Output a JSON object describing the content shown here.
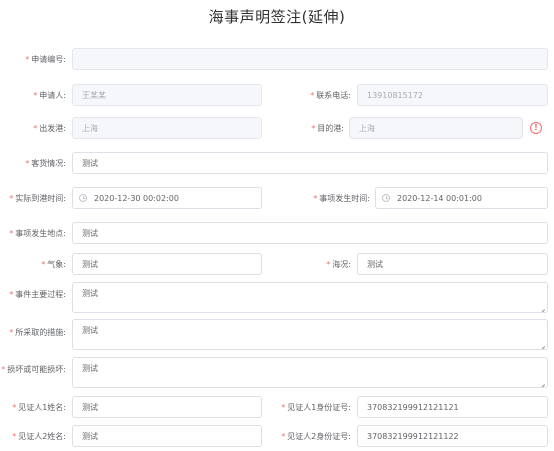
{
  "title": "海事声明签注(延伸)",
  "required_mark": "*",
  "fields": {
    "application_no": {
      "label": "申请编号:",
      "value": ""
    },
    "applicant": {
      "label": "申请人:",
      "value": "王某某"
    },
    "phone": {
      "label": "联系电话:",
      "value": "13910815172"
    },
    "departure_port": {
      "label": "出发港:",
      "value": "上海"
    },
    "destination_port": {
      "label": "目的港:",
      "value": "上海"
    },
    "cargo": {
      "label": "客货情况:",
      "value": "测试"
    },
    "actual_arrival_time": {
      "label": "实际到港时间:",
      "value": "2020-12-30 00:02:00"
    },
    "incident_time": {
      "label": "事项发生时间:",
      "value": "2020-12-14 00:01:00"
    },
    "incident_location": {
      "label": "事项发生地点:",
      "value": "测试"
    },
    "weather": {
      "label": "气象:",
      "value": "测试"
    },
    "sea_condition": {
      "label": "海况:",
      "value": "测试"
    },
    "main_process": {
      "label": "事件主要过程:",
      "value": "测试"
    },
    "measures": {
      "label": "所采取的措施:",
      "value": "测试"
    },
    "damage": {
      "label": "损坏或可能损坏:",
      "value": "测试"
    },
    "witness1_name": {
      "label": "见证人1姓名:",
      "value": "测试"
    },
    "witness1_id": {
      "label": "见证人1身份证号:",
      "value": "370832199912121121"
    },
    "witness2_name": {
      "label": "见证人2姓名:",
      "value": "测试"
    },
    "witness2_id": {
      "label": "见证人2身份证号:",
      "value": "370832199912121122"
    }
  },
  "icons": {
    "alert": "exclamation-circle-icon",
    "clock": "clock-icon",
    "resize": "resize-handle-icon"
  },
  "colors": {
    "required": "#f56c6c",
    "border": "#dcdfe6",
    "disabled_bg": "#f5f7fa",
    "alert": "#f56c6c"
  }
}
